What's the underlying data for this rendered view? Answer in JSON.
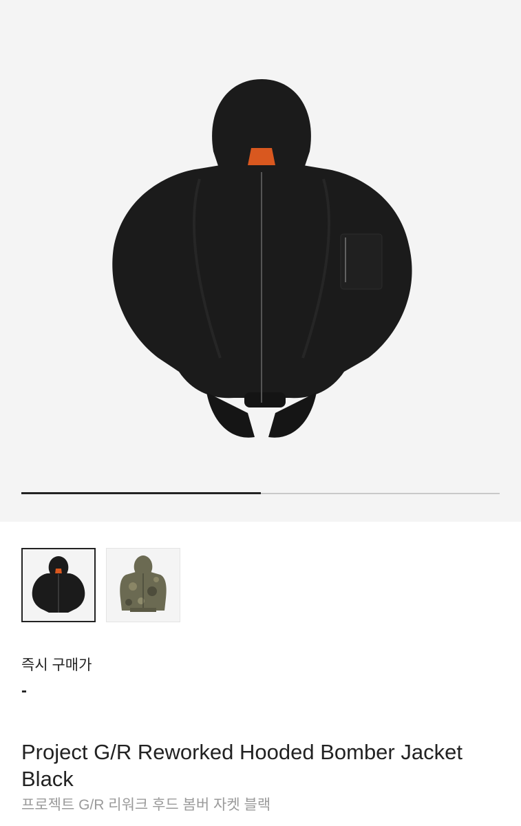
{
  "gallery": {
    "progress": 0.5,
    "images": [
      {
        "alt": "black-hooded-bomber-jacket",
        "selected": true
      },
      {
        "alt": "camo-hooded-bomber-jacket",
        "selected": false
      }
    ]
  },
  "product": {
    "price_label": "즉시 구매가",
    "price_value": "-",
    "title_en": "Project G/R Reworked Hooded Bomber Jacket Black",
    "title_ko": "프로젝트 G/R 리워크 후드 봄버 자켓 블랙"
  },
  "colors": {
    "hero_background": "#f4f4f4",
    "jacket": "#1b1b1b",
    "lining": "#d9581f",
    "camo": "#6b6a52",
    "text_primary": "#222222",
    "text_secondary": "#9a9a9a"
  }
}
